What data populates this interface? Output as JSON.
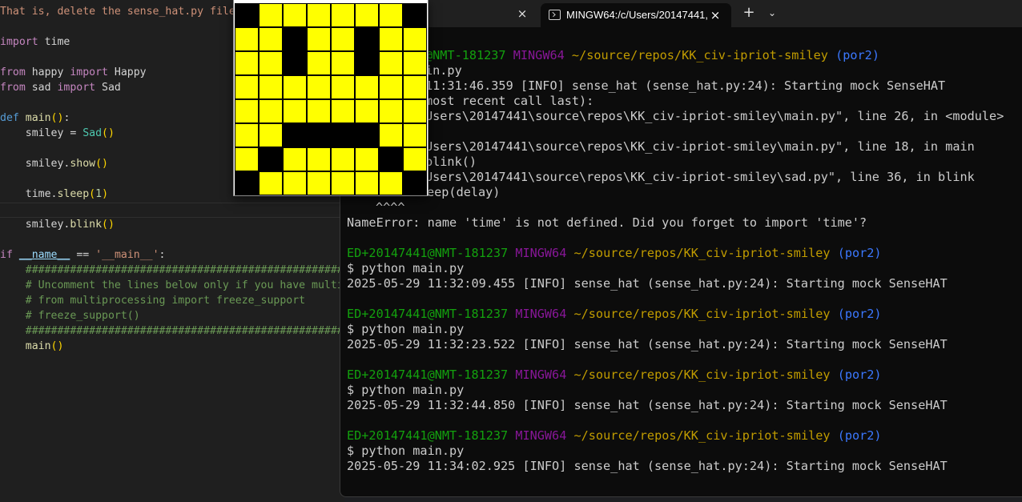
{
  "editor": {
    "lines": {
      "l01": "That is, delete the sense_hat.py file",
      "import": "import",
      "time_mod": " time",
      "from1": "from",
      "happy_mod": " happy ",
      "import2": "import",
      "happy_cls": " Happy",
      "from2": "from",
      "sad_mod": " sad ",
      "import3": "import",
      "sad_cls": " Sad",
      "def": "def",
      "main_fn": "main",
      "smiley_assign": "    smiley = ",
      "sad_call": "Sad",
      "smiley_show_obj": "    smiley.",
      "show_fn": "show",
      "time_sleep_obj": "    time.",
      "sleep_fn": "sleep",
      "sleep_arg": "1",
      "smiley_blink_obj": "    smiley.",
      "blink_fn": "blink",
      "if": "if",
      "name_var": "__name__",
      "eq": " == ",
      "main_str": "'__main__'",
      "colon": ":",
      "hash_line": "    #####################################################",
      "comment1": "    # Uncomment the lines below only if you have multi-",
      "comment2": "    # from multiprocessing import freeze_support",
      "comment3": "    # freeze_support()",
      "hash_line2": "    #####################################################",
      "main_call": "    main"
    }
  },
  "terminal": {
    "tab_title": "MINGW64:/c/Users/20147441,",
    "prompt_user": "ED+20147441@NMT-181237",
    "prompt_env": "MINGW64",
    "prompt_path": "~/source/repos/KK_civ-ipriot-smiley",
    "prompt_branch": "(por2)",
    "partial_prompt_user": "@NMT-181237",
    "partial_cmd": "in.py",
    "partial_info": "11:31:46.359 [INFO] sense_hat (sense_hat.py:24): Starting mock SenseHAT",
    "traceback_head": "most recent call last):",
    "tb1": "Users\\20147441\\source\\repos\\KK_civ-ipriot-smiley\\main.py\", line 26, in <module>",
    "tb2": "Users\\20147441\\source\\repos\\KK_civ-ipriot-smiley\\main.py\", line 18, in main",
    "tb2b": "blink()",
    "tb3": "Users\\20147441\\source\\repos\\KK_civ-ipriot-smiley\\sad.py\", line 36, in blink",
    "tb3b": "time.sleep(delay)",
    "tb3c": "^^^^",
    "name_error": "NameError: name 'time' is not defined. Did you forget to import 'time'?",
    "cmd": "$ python main.py",
    "runs": [
      "2025-05-29 11:32:09.455 [INFO] sense_hat (sense_hat.py:24): Starting mock SenseHAT",
      "2025-05-29 11:32:23.522 [INFO] sense_hat (sense_hat.py:24): Starting mock SenseHAT",
      "2025-05-29 11:32:44.850 [INFO] sense_hat (sense_hat.py:24): Starting mock SenseHAT",
      "2025-05-29 11:34:02.925 [INFO] sense_hat (sense_hat.py:24): Starting mock SenseHAT"
    ]
  },
  "icons": {
    "close": "×",
    "new_tab": "+",
    "dropdown": "⌄"
  },
  "smiley_grid": [
    [
      0,
      1,
      1,
      1,
      1,
      1,
      1,
      0
    ],
    [
      1,
      1,
      0,
      1,
      1,
      0,
      1,
      1
    ],
    [
      1,
      1,
      0,
      1,
      1,
      0,
      1,
      1
    ],
    [
      1,
      1,
      1,
      1,
      1,
      1,
      1,
      1
    ],
    [
      1,
      1,
      1,
      1,
      1,
      1,
      1,
      1
    ],
    [
      1,
      1,
      0,
      0,
      0,
      0,
      1,
      1
    ],
    [
      1,
      0,
      1,
      1,
      1,
      1,
      0,
      1
    ],
    [
      0,
      1,
      1,
      1,
      1,
      1,
      1,
      0
    ]
  ],
  "colors": {
    "led_on": "#ffff00",
    "led_off": "#000000",
    "prompt_green": "#13a10e",
    "prompt_magenta": "#881798",
    "prompt_yellow": "#c19c00",
    "prompt_cyan": "#3b78ff"
  }
}
